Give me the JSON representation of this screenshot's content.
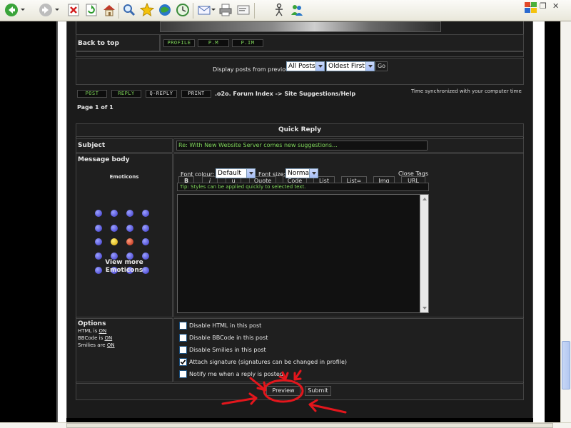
{
  "browser": {
    "toolbar_icons": [
      "back-icon",
      "forward-icon",
      "stop-icon",
      "refresh-icon",
      "home-icon",
      "search-icon",
      "favorites-icon",
      "media-icon",
      "history-icon",
      "mail-icon",
      "print-icon",
      "edit-icon",
      "messenger-icon",
      "users-icon"
    ],
    "window_controls": {
      "minimize": "–",
      "restore": "❐",
      "close": "✕"
    }
  },
  "forum": {
    "back_to_top": "Back to top",
    "profile_btn": "PROFILE",
    "pm_btn": "P.M",
    "pim_btn": "P.IM",
    "display_label": "Display posts from previous:",
    "display_select": "All Posts",
    "order_select": "Oldest First",
    "go_btn": "Go",
    "post_btn": "POST",
    "reply_btn": "REPLY",
    "qreply_btn": "Q-REPLY",
    "print_btn": "PRINT",
    "breadcrumb": ".o2o. Forum Index -> Site Suggestions/Help",
    "time_sync": "Time synchronized with your computer time",
    "page_info": "Page 1 of 1"
  },
  "quick_reply": {
    "title": "Quick Reply",
    "subject_label": "Subject",
    "subject_value": "Re: With New Website Server comes new suggestions...",
    "body_label": "Message body",
    "emoticons_label": "Emoticons",
    "view_more": "View more",
    "view_more_2": "Emoticons",
    "bbcode": {
      "b": "B",
      "i": "i",
      "u": "u",
      "quote": "Quote",
      "code": "Code",
      "list": "List",
      "list_eq": "List=",
      "img": "Img",
      "url": "URL"
    },
    "font_colour_label": "Font colour:",
    "font_colour_value": "Default",
    "font_size_label": "Font size:",
    "font_size_value": "Normal",
    "close_tags": "Close Tags",
    "tip": "Tip: Styles can be applied quickly to selected text."
  },
  "options": {
    "title": "Options",
    "html_status": "HTML is ",
    "html_on": "ON",
    "bbcode_status": "BBCode is ",
    "bbcode_on": "ON",
    "smilies_status": "Smilies are ",
    "smilies_on": "ON",
    "disable_html": "Disable HTML in this post",
    "disable_bbcode": "Disable BBCode in this post",
    "disable_smilies": "Disable Smilies in this post",
    "attach_sig": "Attach signature (signatures can be changed in profile)",
    "notify": "Notify me when a reply is posted"
  },
  "actions": {
    "preview": "Preview",
    "submit": "Submit"
  },
  "colors": {
    "annotation": "#e3161c",
    "green_text": "#7fd65a",
    "page_bg": "#1b1b1b"
  }
}
